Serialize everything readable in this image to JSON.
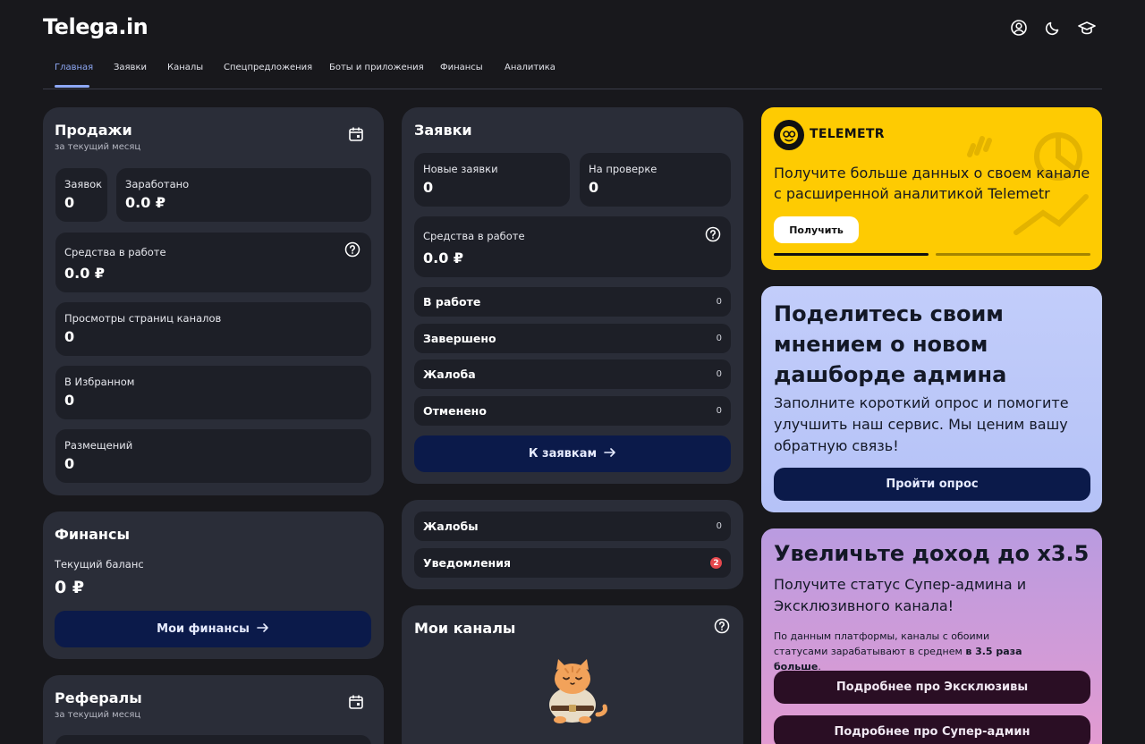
{
  "app": {
    "logo": "Telega.in",
    "header_icons": [
      "user-icon",
      "moon-icon",
      "graduation-cap-icon"
    ]
  },
  "nav": {
    "tabs": [
      {
        "label": "Главная",
        "active": true
      },
      {
        "label": "Заявки",
        "active": false
      },
      {
        "label": "Каналы",
        "active": false
      },
      {
        "label": "Спецпредложения",
        "active": false
      },
      {
        "label": "Боты и приложения",
        "active": false
      },
      {
        "label": "Финансы",
        "active": false
      },
      {
        "label": "Аналитика",
        "active": false
      }
    ]
  },
  "sales": {
    "title": "Продажи",
    "subtitle": "за текущий месяц",
    "requests_label": "Заявок",
    "requests_value": "0",
    "earned_label": "Заработано",
    "earned_value": "0.0 ₽",
    "in_work_label": "Средства в работе",
    "in_work_value": "0.0 ₽",
    "views_label": "Просмотры страниц каналов",
    "views_value": "0",
    "favorites_label": "В Избранном",
    "favorites_value": "0",
    "placements_label": "Размещений",
    "placements_value": "0"
  },
  "finances": {
    "title": "Финансы",
    "balance_label": "Текущий баланс",
    "balance_value": "0 ₽",
    "button": "Мои финансы"
  },
  "referrals": {
    "title": "Рефералы",
    "subtitle": "за текущий месяц"
  },
  "requests": {
    "title": "Заявки",
    "new_label": "Новые заявки",
    "new_value": "0",
    "review_label": "На проверке",
    "review_value": "0",
    "in_work_label": "Средства в работе",
    "in_work_value": "0.0 ₽",
    "statuses": [
      {
        "label": "В работе",
        "count": "0"
      },
      {
        "label": "Завершено",
        "count": "0"
      },
      {
        "label": "Жалоба",
        "count": "0"
      },
      {
        "label": "Отменено",
        "count": "0"
      }
    ],
    "button": "К заявкам"
  },
  "alerts": {
    "complaints_label": "Жалобы",
    "complaints_count": "0",
    "notifications_label": "Уведомления",
    "notifications_count": "2"
  },
  "my_channels": {
    "title": "Мои каналы"
  },
  "telemetr": {
    "brand": "TELEMETR",
    "text": "Получите больше данных о своем канале с расширенной аналитикой Telemetr",
    "button": "Получить"
  },
  "survey": {
    "title": "Поделитесь своим мнением о новом дашборде админа",
    "text": "Заполните короткий опрос и помогите улучшить наш сервис. Мы ценим вашу обратную связь!",
    "button": "Пройти опрос"
  },
  "income": {
    "title": "Увеличьте доход до x3.5",
    "text": "Получите статус Супер-админа и Эксклюзивного канала!",
    "small_text_1": "По данным платформы, каналы с обоими статусами зарабатывают в среднем ",
    "small_text_bold": "в 3.5 раза больше",
    "small_text_2": ".",
    "button_exclusive": "Подробнее про Эксклюзивы",
    "button_superadmin": "Подробнее про Супер-админ"
  },
  "colors": {
    "accent": "#8ea8f5",
    "background": "#18181c",
    "card": "#2a2d38",
    "tile": "#1d1f27",
    "button": "#0b1a4a",
    "yellow": "#fecb02",
    "badge": "#e5484d"
  }
}
